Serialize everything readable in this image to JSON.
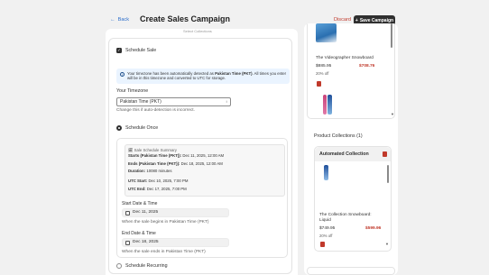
{
  "header": {
    "back_label": "Back",
    "title": "Create Sales Campaign",
    "discard_label": "Discard",
    "save_label": "Save Campaign"
  },
  "schedule": {
    "top_cut_text": "Select Collections",
    "schedule_sale_label": "Schedule Sale",
    "info_text_pre": "Your timezone has been automatically detected as ",
    "info_text_bold": "Pakistan Time (PKT)",
    "info_text_post": ". All times you enter will be in this timezone and converted to UTC for storage.",
    "timezone_label": "Your Timezone",
    "timezone_value": "Pakistan Time (PKT)",
    "timezone_help": "Change this if auto-detection is incorrect.",
    "schedule_once_label": "Schedule Once",
    "summary": {
      "title": "Sale Schedule Summary",
      "starts_label": "Starts (Pakistan Time (PKT)):",
      "starts_value": "Dec 11, 2025, 12:00 AM",
      "ends_label": "Ends (Pakistan Time (PKT)):",
      "ends_value": "Dec 18, 2025, 12:00 AM",
      "duration_label": "Duration:",
      "duration_value": "10080 minutes",
      "utc_start_label": "UTC Start:",
      "utc_start_value": "Dec 10, 2025, 7:00 PM",
      "utc_end_label": "UTC End:",
      "utc_end_value": "Dec 17, 2025, 7:00 PM"
    },
    "start_label": "Start Date & Time",
    "start_value": "Dec 11, 2025",
    "start_help": "When the sale begins in Pakistan Time (PKT)",
    "end_label": "End Date & Time",
    "end_value": "Dec 18, 2025",
    "end_help": "When the sale ends in Pakistan Time (PKT)",
    "recurring_label": "Schedule Recurring"
  },
  "products": {
    "item_title": "The Videographer Snowboard",
    "item_price": "$885.95",
    "item_sale": "$708.76",
    "item_off": "20% off"
  },
  "collections": {
    "title": "Product Collections (1)",
    "card_title": "Automated Collection",
    "item_title_line1": "The Collection Snowboard:",
    "item_title_line2": "Liquid",
    "item_price": "$749.95",
    "item_sale": "$599.96",
    "item_off": "20% off"
  },
  "colors": {
    "accent": "#2c6ecb",
    "danger": "#c0392b",
    "primary_button": "#303030",
    "info_bg": "#eaf4ff"
  }
}
